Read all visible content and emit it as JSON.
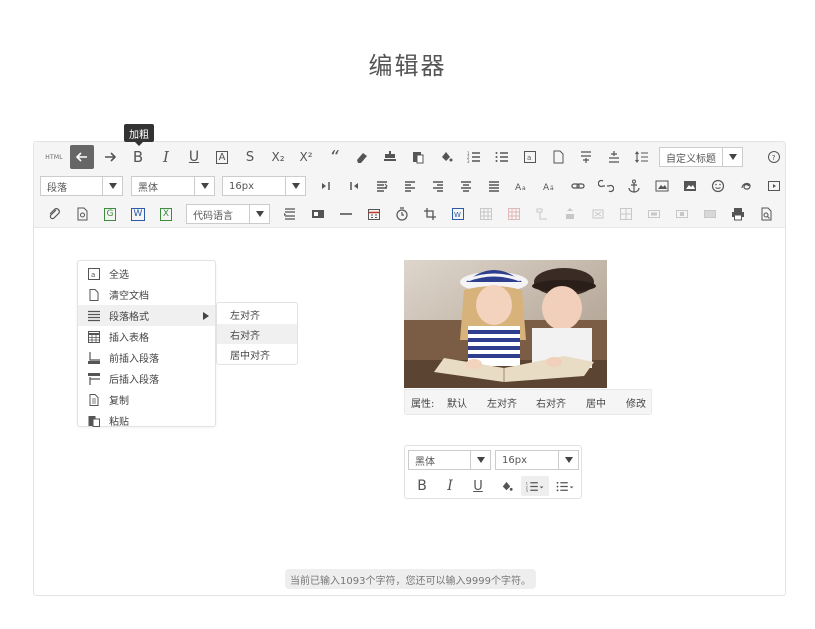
{
  "page": {
    "title": "编辑器"
  },
  "toolbar": {
    "tooltip": "加粗",
    "html_label": "HTML",
    "heading_select": "自定义标题",
    "paragraph_select": "段落",
    "font_select": "黑体",
    "size_select": "16px",
    "code_select": "代码语言",
    "row1_icons": [
      "html-icon",
      "undo-icon",
      "redo-icon",
      "bold-icon",
      "italic-icon",
      "underline-icon",
      "font-border-icon",
      "strikethrough-icon",
      "subscript-icon",
      "superscript-icon",
      "blockquote-icon",
      "eraser-icon",
      "format-match-icon",
      "paste-plain-icon",
      "background-color-icon",
      "ordered-list-icon",
      "unordered-list-icon",
      "select-all-icon",
      "clear-doc-icon",
      "row-spacing-top-icon",
      "row-spacing-bottom-icon",
      "line-height-icon"
    ],
    "right_icon": "help-icon",
    "icon_labels": {
      "bold": "B",
      "italic": "I",
      "underline": "U",
      "strike": "S",
      "boxed": "A",
      "sub": "X₂",
      "sup": "X²",
      "quote": "“",
      "word": "W",
      "excel": "X",
      "google": "G"
    }
  },
  "context_menu": {
    "items": [
      {
        "label": "全选",
        "icon": "select-all-icon"
      },
      {
        "label": "清空文档",
        "icon": "document-icon"
      },
      {
        "label": "段落格式",
        "icon": "paragraph-icon",
        "has_submenu": true
      },
      {
        "label": "插入表格",
        "icon": "table-icon"
      },
      {
        "label": "前插入段落",
        "icon": "insert-before-icon"
      },
      {
        "label": "后插入段落",
        "icon": "insert-after-icon"
      },
      {
        "label": "复制",
        "icon": "copy-icon"
      },
      {
        "label": "粘贴",
        "icon": "paste-icon"
      }
    ],
    "submenu": [
      {
        "label": "左对齐"
      },
      {
        "label": "右对齐"
      },
      {
        "label": "居中对齐"
      }
    ]
  },
  "image_toolbar": {
    "label": "属性:",
    "options": [
      "默认",
      "左对齐",
      "右对齐",
      "居中",
      "修改"
    ]
  },
  "float_toolbar": {
    "font": "黑体",
    "size": "16px",
    "bold": "B",
    "italic": "I",
    "underline": "U"
  },
  "status": {
    "text": "当前已输入1093个字符，您还可以输入9999个字符。"
  }
}
